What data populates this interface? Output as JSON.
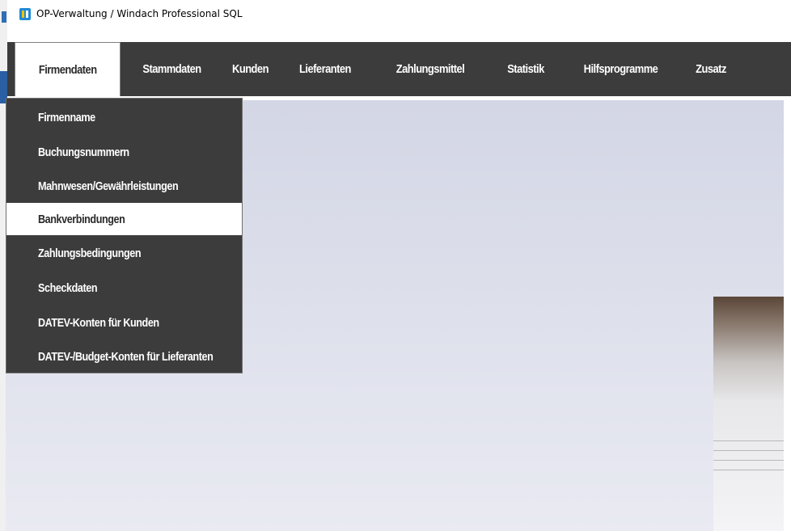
{
  "window": {
    "title": "OP-Verwaltung / Windach Professional SQL"
  },
  "menu_bar": {
    "items": [
      {
        "label": "Firmendaten",
        "active": true
      },
      {
        "label": "Stammdaten"
      },
      {
        "label": "Kunden"
      },
      {
        "label": "Lieferanten"
      },
      {
        "label": "Zahlungsmittel"
      },
      {
        "label": "Statistik"
      },
      {
        "label": "Hilfsprogramme"
      },
      {
        "label": "Zusatz"
      }
    ]
  },
  "dropdown": {
    "items": [
      {
        "label": "Firmenname"
      },
      {
        "label": "Buchungsnummern"
      },
      {
        "label": "Mahnwesen/Gewährleistungen"
      },
      {
        "label": "Bankverbindungen",
        "highlighted": true
      },
      {
        "label": "Zahlungsbedingungen"
      },
      {
        "label": "Scheckdaten"
      },
      {
        "label": "DATEV-Konten für Kunden"
      },
      {
        "label": "DATEV-/Budget-Konten für Lieferanten"
      }
    ]
  },
  "colors": {
    "menu_background": "#3c3c3c",
    "menu_text": "#ffffff",
    "highlight_background": "#ffffff",
    "highlight_text": "#2b2b2b",
    "content_background_top": "#d3d6e5",
    "content_background_bottom": "#e9eaf2"
  },
  "icons": {
    "app_icon": "app-logo-icon"
  }
}
